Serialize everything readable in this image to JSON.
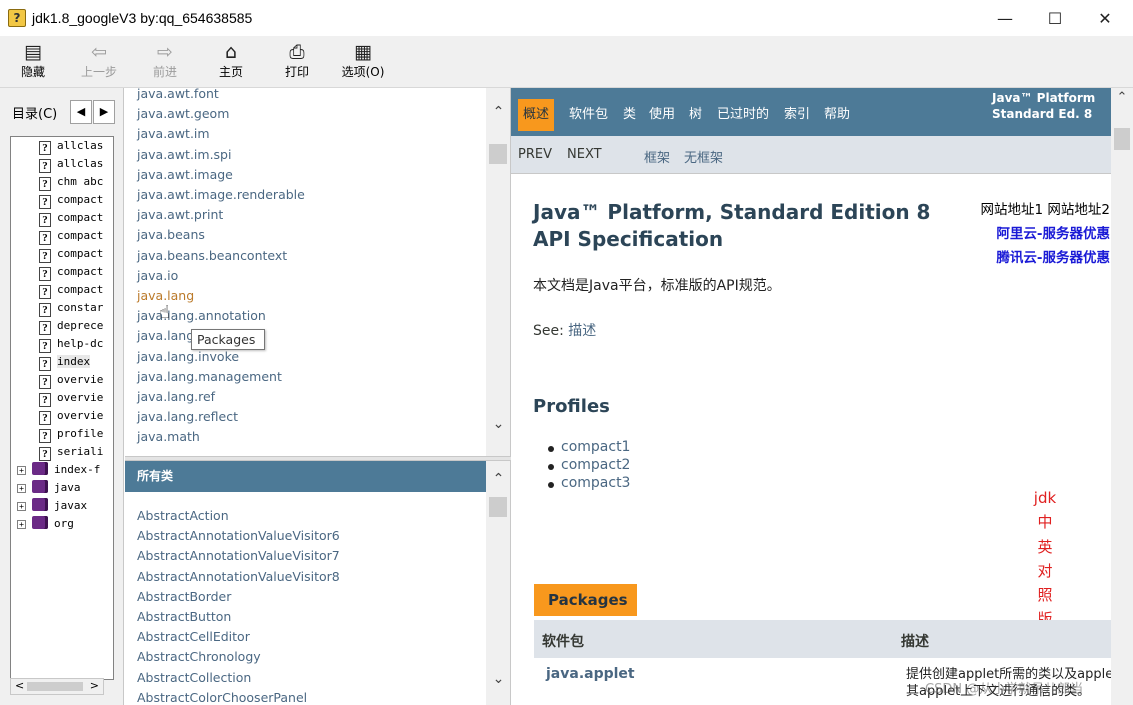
{
  "window": {
    "title": "jdk1.8_googleV3 by:qq_654638585",
    "controls": {
      "minimize": "—",
      "maximize": "☐",
      "close": "✕"
    }
  },
  "toolbar": {
    "hide": {
      "label": "隐藏",
      "icon": "▤"
    },
    "back": {
      "label": "上一步",
      "icon": "⇦"
    },
    "forward": {
      "label": "前进",
      "icon": "⇨"
    },
    "home": {
      "label": "主页",
      "icon": "⌂"
    },
    "print": {
      "label": "打印",
      "icon": "⎙"
    },
    "options": {
      "label": "选项(O)",
      "icon": "▦"
    }
  },
  "toc": {
    "tab_label": "目录(C)",
    "arrow_left": "◀",
    "arrow_right": "▶",
    "help_items": [
      "allclas",
      "allclas",
      "chm abc",
      "compact",
      "compact",
      "compact",
      "compact",
      "compact",
      "compact",
      "constar",
      "deprece",
      "help-dc",
      "index",
      "overvie",
      "overvie",
      "overvie",
      "profile",
      "seriali"
    ],
    "book_items": [
      "index-f",
      "java",
      "javax",
      "org"
    ],
    "expand_symbol": "+",
    "scroll_left": "<",
    "scroll_right": ">"
  },
  "packages_frame": {
    "items": [
      "java.awt.font",
      "java.awt.geom",
      "java.awt.im",
      "java.awt.im.spi",
      "java.awt.image",
      "java.awt.image.renderable",
      "java.awt.print",
      "java.beans",
      "java.beans.beancontext",
      "java.io",
      "java.lang",
      "java.lang.annotation",
      "java.lang",
      "java.lang.invoke",
      "java.lang.management",
      "java.lang.ref",
      "java.lang.reflect",
      "java.math"
    ],
    "tooltip": "Packages",
    "scroll_up": "⌃",
    "scroll_down": "⌄"
  },
  "classes_frame": {
    "header": "所有类",
    "items": [
      "AbstractAction",
      "AbstractAnnotationValueVisitor6",
      "AbstractAnnotationValueVisitor7",
      "AbstractAnnotationValueVisitor8",
      "AbstractBorder",
      "AbstractButton",
      "AbstractCellEditor",
      "AbstractChronology",
      "AbstractCollection",
      "AbstractColorChooserPanel"
    ],
    "scroll_up": "⌃",
    "scroll_down": "⌄"
  },
  "content": {
    "nav": [
      "概述",
      "软件包",
      "类",
      "使用",
      "树",
      "已过时的",
      "索引",
      "帮助"
    ],
    "about_line1": "Java™ Platform",
    "about_line2": "Standard Ed. 8",
    "subnav": {
      "prev": "PREV",
      "next": "NEXT",
      "frames": "框架",
      "noframes": "无框架"
    },
    "title_line1": "Java™ Platform, Standard Edition 8",
    "title_line2": "API Specification",
    "site_links": {
      "plain": "网站地址1 网站地址2",
      "aliyun": "阿里云-服务器优惠",
      "tencent": "腾讯云-服务器优惠"
    },
    "description": "本文档是Java平台，标准版的API规范。",
    "see_label": "See: ",
    "see_link": "描述",
    "profiles_heading": "Profiles",
    "profiles": [
      "compact1",
      "compact2",
      "compact3"
    ],
    "red_note": [
      "jdk",
      "中",
      "英",
      "对",
      "照",
      "版"
    ],
    "packages_caption": "Packages",
    "table_headers": {
      "package": "软件包",
      "description": "描述"
    },
    "first_row": {
      "package": "java.applet",
      "desc_line1": "提供创建applet所需的类以及applet",
      "desc_line2": "其applet上下文进行通信的类。"
    },
    "watermark": "CSDN @从小学就吊儿郎当"
  }
}
